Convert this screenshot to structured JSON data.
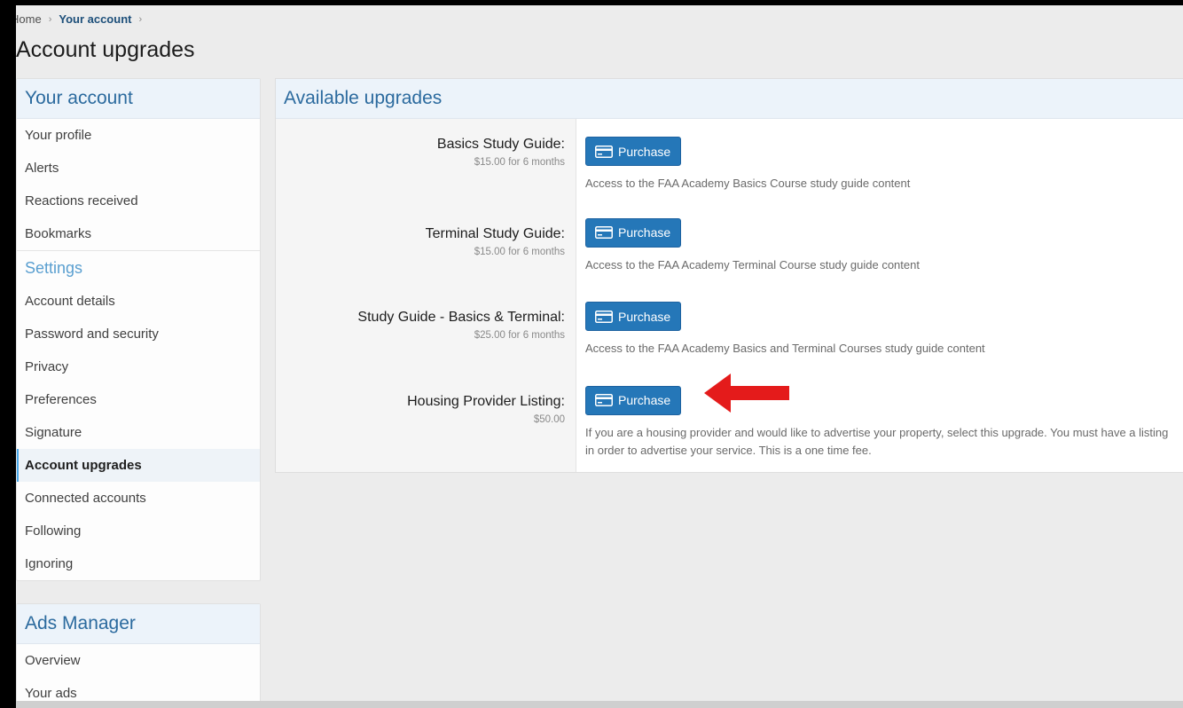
{
  "breadcrumb": {
    "home": "Home",
    "current": "Your account",
    "sep": "›"
  },
  "page_title": "Account upgrades",
  "sidebar": {
    "account_header": "Your account",
    "account_items": [
      {
        "label": "Your profile"
      },
      {
        "label": "Alerts"
      },
      {
        "label": "Reactions received"
      },
      {
        "label": "Bookmarks"
      }
    ],
    "settings_header": "Settings",
    "settings_items": [
      {
        "label": "Account details"
      },
      {
        "label": "Password and security"
      },
      {
        "label": "Privacy"
      },
      {
        "label": "Preferences"
      },
      {
        "label": "Signature"
      },
      {
        "label": "Account upgrades",
        "active": true
      },
      {
        "label": "Connected accounts"
      },
      {
        "label": "Following"
      },
      {
        "label": "Ignoring"
      }
    ],
    "ads_header": "Ads Manager",
    "ads_items": [
      {
        "label": "Overview"
      },
      {
        "label": "Your ads"
      }
    ]
  },
  "main": {
    "header": "Available upgrades",
    "upgrades": [
      {
        "title": "Basics Study Guide:",
        "price": "$15.00 for 6 months",
        "button": "Purchase",
        "description": "Access to the FAA Academy Basics Course study guide content"
      },
      {
        "title": "Terminal Study Guide:",
        "price": "$15.00 for 6 months",
        "button": "Purchase",
        "description": "Access to the FAA Academy Terminal Course study guide content"
      },
      {
        "title": "Study Guide - Basics & Terminal:",
        "price": "$25.00 for 6 months",
        "button": "Purchase",
        "description": "Access to the FAA Academy Basics and Terminal Courses study guide content"
      },
      {
        "title": "Housing Provider Listing:",
        "price": "$50.00",
        "button": "Purchase",
        "description": "If you are a housing provider and would like to advertise your property, select this upgrade. You must have a listing in order to advertise your service. This is a one time fee."
      }
    ]
  },
  "colors": {
    "accent": "#2577b8",
    "header_text": "#2b6a9e",
    "annotation_arrow": "#e41b1b"
  },
  "icons": {
    "purchase": "credit-card-icon",
    "annotation": "red-arrow-left"
  }
}
